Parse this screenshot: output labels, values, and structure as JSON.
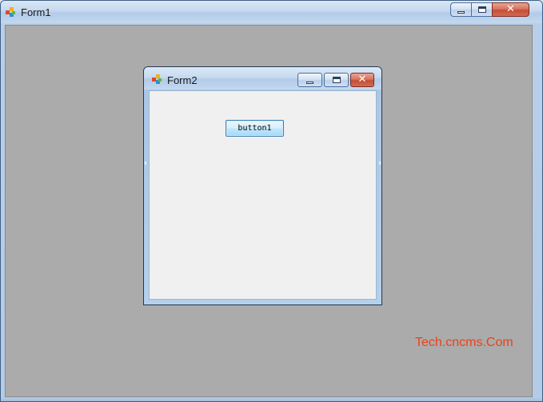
{
  "form1": {
    "title": "Form1",
    "icon": "windows-form-icon",
    "controls": {
      "minimize": "minimize-icon",
      "maximize": "maximize-icon",
      "close": "close-icon"
    },
    "client_bg": "#ababab"
  },
  "form2": {
    "title": "Form2",
    "icon": "windows-form-icon",
    "controls": {
      "minimize": "minimize-icon",
      "maximize": "maximize-icon",
      "close": "close-icon"
    },
    "button1": {
      "label": "button1"
    }
  },
  "watermark": {
    "text": "Tech.cncms.Com",
    "color": "#e8431c"
  },
  "colors": {
    "titlebar": "#c4d8ef",
    "close_button": "#c54d34",
    "button_face": "#bee6fd"
  }
}
